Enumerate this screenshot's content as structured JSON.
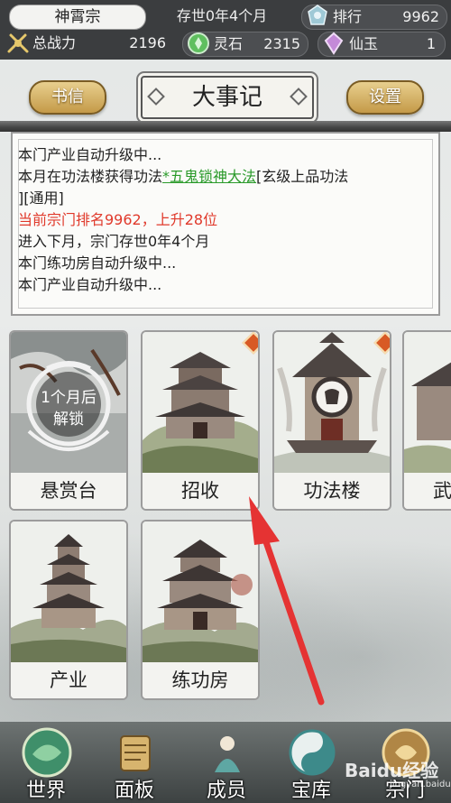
{
  "status_bar": {
    "sect_name": "神霄宗",
    "sect_age": "存世0年4个月",
    "rank_label": "排行",
    "rank_value": "9962",
    "power_label": "总战力",
    "power_value": "2196",
    "spirit_stone_label": "灵石",
    "spirit_stone_value": "2315",
    "immortal_jade_label": "仙玉",
    "immortal_jade_value": "1"
  },
  "header": {
    "letters_button": "书信",
    "title": "大事记",
    "settings_button": "设置"
  },
  "event_log": {
    "line1": "本门产业自动升级中...",
    "line2_prefix": "本月在功法楼获得功法",
    "line2_link": "*五鬼锁神大法",
    "line2_suffix": "[玄级上品功法",
    "line3": "][通用]",
    "line4": "当前宗门排名9962，上升28位",
    "line5": "进入下月，宗门存世0年4个月",
    "line6": "本门练功房自动升级中...",
    "line7": "本门产业自动升级中..."
  },
  "buildings": {
    "bounty": {
      "label": "悬赏台",
      "lock_text_1": "1个月后",
      "lock_text_2": "解锁"
    },
    "recruit": {
      "label": "招收"
    },
    "skills": {
      "label": "功法楼"
    },
    "martial": {
      "label": "武"
    },
    "industry": {
      "label": "产业"
    },
    "training": {
      "label": "练功房"
    }
  },
  "bottom_nav": {
    "world": "世界",
    "panel": "面板",
    "members": "成员",
    "treasury": "宝库",
    "sect": "宗门"
  },
  "watermark": {
    "brand": "Baidu经验",
    "url": "jingyan.baidu.com"
  },
  "colors": {
    "top_bar": "#3b3d3f",
    "gold_button": "#c49a48",
    "highlight_red": "#e0392b",
    "link_green": "#2a9a2a",
    "badge_orange": "#d85a25",
    "arrow_red": "#e53333"
  }
}
